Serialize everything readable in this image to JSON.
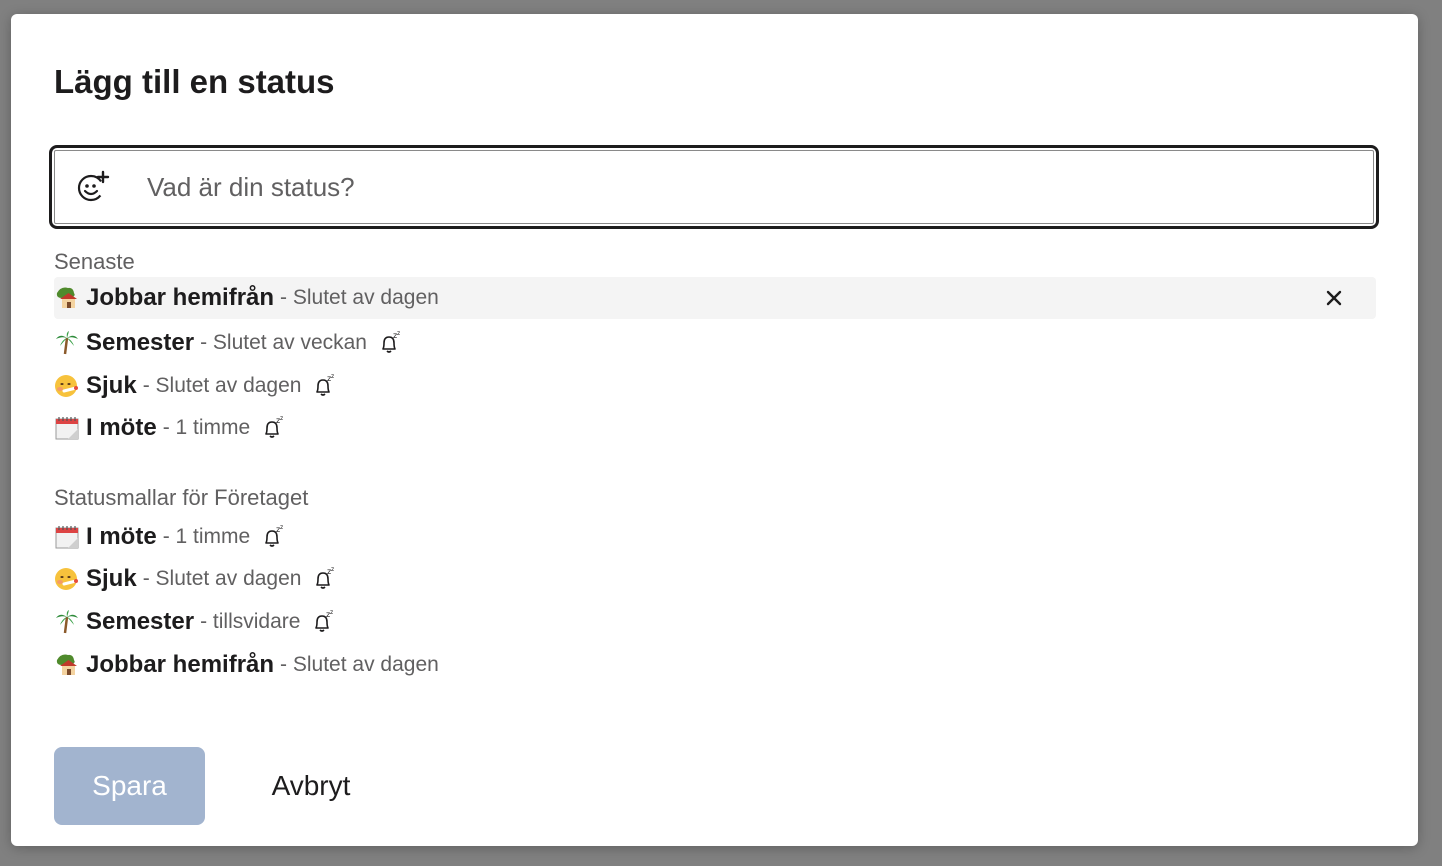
{
  "dialog": {
    "title": "Lägg till en status",
    "input": {
      "placeholder": "Vad är din status?",
      "value": ""
    },
    "recent": {
      "label": "Senaste",
      "items": [
        {
          "emoji": "house-with-tree",
          "name": "Jobbar hemifrån",
          "duration": "- Slutet av dagen",
          "snooze": false
        },
        {
          "emoji": "palm-tree",
          "name": "Semester",
          "duration": "- Slutet av veckan",
          "snooze": true
        },
        {
          "emoji": "face-with-thermometer",
          "name": "Sjuk",
          "duration": "- Slutet av dagen",
          "snooze": true
        },
        {
          "emoji": "spiral-calendar",
          "name": "I möte",
          "duration": "- 1 timme",
          "snooze": true
        }
      ]
    },
    "templates": {
      "label": "Statusmallar för Företaget",
      "items": [
        {
          "emoji": "spiral-calendar",
          "name": "I möte",
          "duration": "- 1 timme",
          "snooze": true
        },
        {
          "emoji": "face-with-thermometer",
          "name": "Sjuk",
          "duration": "- Slutet av dagen",
          "snooze": true
        },
        {
          "emoji": "palm-tree",
          "name": "Semester",
          "duration": "- tillsvidare",
          "snooze": true
        },
        {
          "emoji": "house-with-tree",
          "name": "Jobbar hemifrån",
          "duration": "- Slutet av dagen",
          "snooze": false
        }
      ]
    },
    "buttons": {
      "save": "Spara",
      "cancel": "Avbryt"
    }
  },
  "colors": {
    "overlay": "#808080",
    "text": "#1d1c1d",
    "muted": "#616061",
    "save_disabled": "#a2b4cf",
    "hover_row": "#f4f4f4"
  }
}
